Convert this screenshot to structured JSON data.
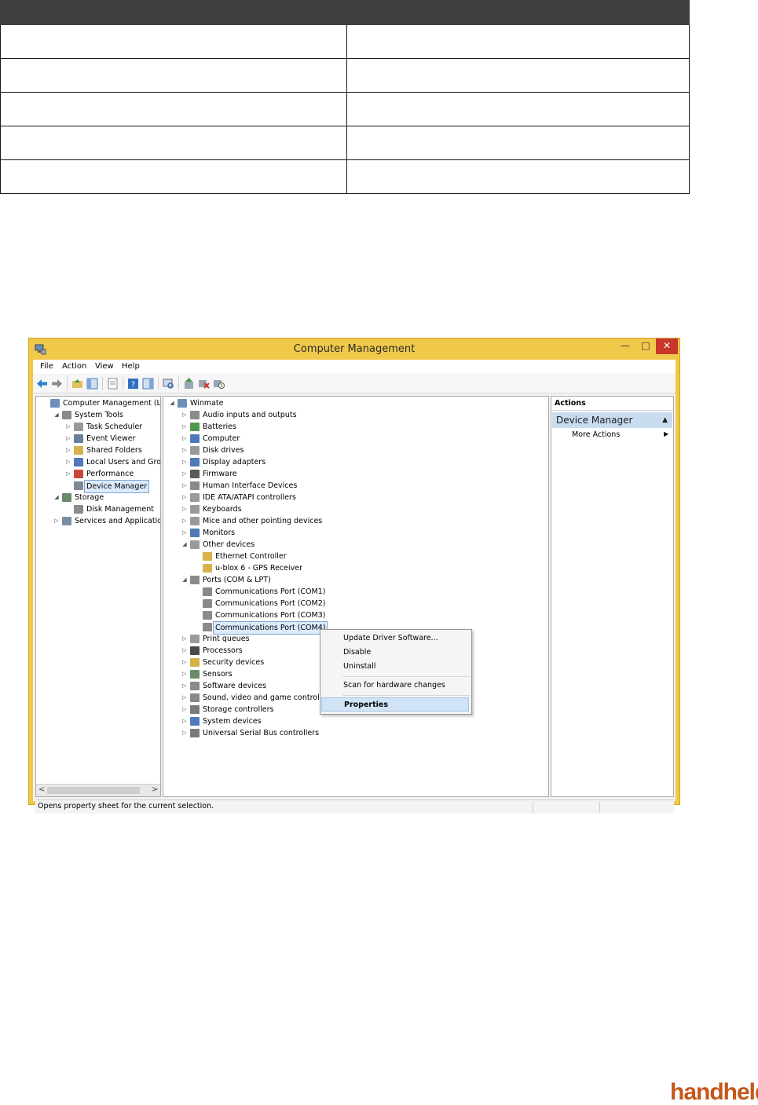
{
  "window": {
    "title": "Computer Management",
    "controls": {
      "minimize": "—",
      "maximize": "□",
      "close": "✕"
    }
  },
  "menu": [
    "File",
    "Action",
    "View",
    "Help"
  ],
  "left_tree": [
    {
      "label": "Computer Management (Local",
      "exp": "",
      "indent": 0,
      "icon": "computer-management-icon",
      "color": "#6b8fb8"
    },
    {
      "label": "System Tools",
      "exp": "◢",
      "indent": 1,
      "icon": "system-tools-icon",
      "color": "#8a8a8a"
    },
    {
      "label": "Task Scheduler",
      "exp": "▷",
      "indent": 2,
      "icon": "task-scheduler-icon",
      "color": "#9a9a9a"
    },
    {
      "label": "Event Viewer",
      "exp": "▷",
      "indent": 2,
      "icon": "event-viewer-icon",
      "color": "#6a7f9a"
    },
    {
      "label": "Shared Folders",
      "exp": "▷",
      "indent": 2,
      "icon": "shared-folders-icon",
      "color": "#d8b14a"
    },
    {
      "label": "Local Users and Groups",
      "exp": "▷",
      "indent": 2,
      "icon": "users-icon",
      "color": "#4f79b8"
    },
    {
      "label": "Performance",
      "exp": "▷",
      "indent": 2,
      "icon": "performance-icon",
      "color": "#c9463b"
    },
    {
      "label": "Device Manager",
      "exp": "",
      "indent": 2,
      "icon": "device-manager-icon",
      "color": "#7f8a96",
      "selected": true
    },
    {
      "label": "Storage",
      "exp": "◢",
      "indent": 1,
      "icon": "storage-icon",
      "color": "#6a8a6a"
    },
    {
      "label": "Disk Management",
      "exp": "",
      "indent": 2,
      "icon": "disk-management-icon",
      "color": "#8a8a8a"
    },
    {
      "label": "Services and Applications",
      "exp": "▷",
      "indent": 1,
      "icon": "services-icon",
      "color": "#7a8fa6"
    }
  ],
  "device_tree": [
    {
      "label": "Winmate",
      "exp": "◢",
      "indent": 0,
      "icon": "computer-icon",
      "color": "#6b8fb8"
    },
    {
      "label": "Audio inputs and outputs",
      "exp": "▷",
      "indent": 1,
      "icon": "audio-icon",
      "color": "#8a8a8a"
    },
    {
      "label": "Batteries",
      "exp": "▷",
      "indent": 1,
      "icon": "battery-icon",
      "color": "#4f9a4f"
    },
    {
      "label": "Computer",
      "exp": "▷",
      "indent": 1,
      "icon": "computer-icon",
      "color": "#4f79b8"
    },
    {
      "label": "Disk drives",
      "exp": "▷",
      "indent": 1,
      "icon": "disk-drive-icon",
      "color": "#9a9a9a"
    },
    {
      "label": "Display adapters",
      "exp": "▷",
      "indent": 1,
      "icon": "display-adapter-icon",
      "color": "#4f79b8"
    },
    {
      "label": "Firmware",
      "exp": "▷",
      "indent": 1,
      "icon": "firmware-icon",
      "color": "#5a5a5a"
    },
    {
      "label": "Human Interface Devices",
      "exp": "▷",
      "indent": 1,
      "icon": "hid-icon",
      "color": "#8a8a8a"
    },
    {
      "label": "IDE ATA/ATAPI controllers",
      "exp": "▷",
      "indent": 1,
      "icon": "ide-icon",
      "color": "#9a9a9a"
    },
    {
      "label": "Keyboards",
      "exp": "▷",
      "indent": 1,
      "icon": "keyboard-icon",
      "color": "#9a9a9a"
    },
    {
      "label": "Mice and other pointing devices",
      "exp": "▷",
      "indent": 1,
      "icon": "mouse-icon",
      "color": "#9a9a9a"
    },
    {
      "label": "Monitors",
      "exp": "▷",
      "indent": 1,
      "icon": "monitor-icon",
      "color": "#4f79b8"
    },
    {
      "label": "Other devices",
      "exp": "◢",
      "indent": 1,
      "icon": "other-devices-icon",
      "color": "#9a9a9a"
    },
    {
      "label": "Ethernet Controller",
      "exp": "",
      "indent": 2,
      "icon": "warning-device-icon",
      "color": "#d8b14a"
    },
    {
      "label": "u-blox 6  -  GPS Receiver",
      "exp": "",
      "indent": 2,
      "icon": "warning-device-icon",
      "color": "#d8b14a"
    },
    {
      "label": "Ports (COM & LPT)",
      "exp": "◢",
      "indent": 1,
      "icon": "port-icon",
      "color": "#8a8a8a"
    },
    {
      "label": "Communications Port (COM1)",
      "exp": "",
      "indent": 2,
      "icon": "port-icon",
      "color": "#8a8a8a"
    },
    {
      "label": "Communications Port (COM2)",
      "exp": "",
      "indent": 2,
      "icon": "port-icon",
      "color": "#8a8a8a"
    },
    {
      "label": "Communications Port (COM3)",
      "exp": "",
      "indent": 2,
      "icon": "port-icon",
      "color": "#8a8a8a"
    },
    {
      "label": "Communications Port (COM4)",
      "exp": "",
      "indent": 2,
      "icon": "port-icon",
      "color": "#8a8a8a",
      "selected": true
    },
    {
      "label": "Print queues",
      "exp": "▷",
      "indent": 1,
      "icon": "printer-icon",
      "color": "#9a9a9a"
    },
    {
      "label": "Processors",
      "exp": "▷",
      "indent": 1,
      "icon": "processor-icon",
      "color": "#4a4a4a"
    },
    {
      "label": "Security devices",
      "exp": "▷",
      "indent": 1,
      "icon": "security-icon",
      "color": "#d8b14a"
    },
    {
      "label": "Sensors",
      "exp": "▷",
      "indent": 1,
      "icon": "sensor-icon",
      "color": "#6a8a6a"
    },
    {
      "label": "Software devices",
      "exp": "▷",
      "indent": 1,
      "icon": "software-device-icon",
      "color": "#8a8a8a"
    },
    {
      "label": "Sound, video and game controllers",
      "exp": "▷",
      "indent": 1,
      "icon": "sound-icon",
      "color": "#8a8a8a"
    },
    {
      "label": "Storage controllers",
      "exp": "▷",
      "indent": 1,
      "icon": "storage-controller-icon",
      "color": "#7a7a7a"
    },
    {
      "label": "System devices",
      "exp": "▷",
      "indent": 1,
      "icon": "system-device-icon",
      "color": "#4f79b8"
    },
    {
      "label": "Universal Serial Bus controllers",
      "exp": "▷",
      "indent": 1,
      "icon": "usb-icon",
      "color": "#7a7a7a"
    }
  ],
  "actions": {
    "header": "Actions",
    "section": "Device Manager",
    "more": "More Actions"
  },
  "context_menu": {
    "update": "Update Driver Software...",
    "disable": "Disable",
    "uninstall": "Uninstall",
    "scan": "Scan for hardware changes",
    "properties": "Properties"
  },
  "status": "Opens property sheet for the current selection.",
  "brand": "handheld",
  "colors": {
    "accent": "#f0c84a",
    "close": "#c7372c",
    "selection": "#dcebfc",
    "brand": "#c4581a"
  }
}
